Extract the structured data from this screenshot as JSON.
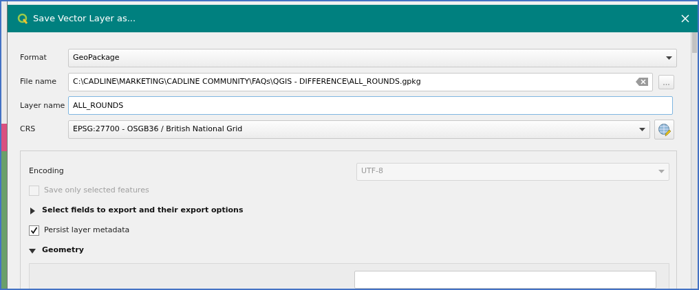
{
  "window": {
    "title": "Save Vector Layer as..."
  },
  "fields": [
    {
      "label": "Format",
      "kind": "combo",
      "value": "GeoPackage",
      "focused": false
    },
    {
      "label": "File name",
      "kind": "file",
      "value": "C:\\CADLINE\\MARKETING\\CADLINE COMMUNITY\\FAQs\\QGIS - DIFFERENCE\\ALL_ROUNDS.gpkg",
      "focused": false
    },
    {
      "label": "Layer name",
      "kind": "text",
      "value": "ALL_ROUNDS",
      "focused": true
    },
    {
      "label": "CRS",
      "kind": "crs",
      "value": "EPSG:27700 - OSGB36 / British National Grid",
      "focused": false
    }
  ],
  "options": {
    "encoding": {
      "label": "Encoding",
      "value": "UTF-8",
      "disabled": true
    },
    "items": [
      {
        "kind": "checkbox",
        "label": "Save only selected features",
        "checked": false,
        "disabled": true
      },
      {
        "kind": "section",
        "label": "Select fields to export and their export options",
        "expanded": false
      },
      {
        "kind": "checkbox",
        "label": "Persist layer metadata",
        "checked": true,
        "disabled": false
      },
      {
        "kind": "section",
        "label": "Geometry",
        "expanded": true
      }
    ]
  }
}
